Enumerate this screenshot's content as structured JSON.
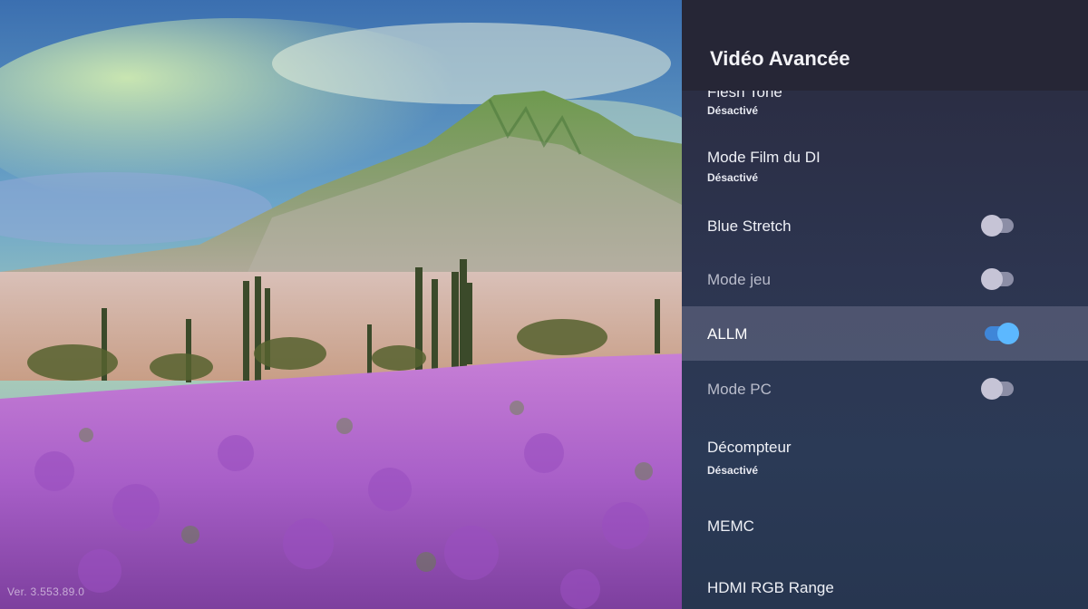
{
  "panel": {
    "title": "Vidéo Avancée",
    "items": [
      {
        "label": "Flesh Tone",
        "value": "Désactivé"
      },
      {
        "label": "Mode Film du DI",
        "value": "Désactivé"
      },
      {
        "label": "Blue Stretch",
        "toggle": "off"
      },
      {
        "label": "Mode jeu",
        "toggle": "off"
      },
      {
        "label": "ALLM",
        "toggle": "on"
      },
      {
        "label": "Mode PC",
        "toggle": "off"
      },
      {
        "label": "Décompteur",
        "value": "Désactivé"
      },
      {
        "label": "MEMC"
      },
      {
        "label": "HDMI RGB Range"
      }
    ]
  },
  "footer": {
    "version": "Ver. 3.553.89.0"
  },
  "colors": {
    "toggle_on": "#5cb8ff",
    "panel_bg": "#2d3550"
  }
}
